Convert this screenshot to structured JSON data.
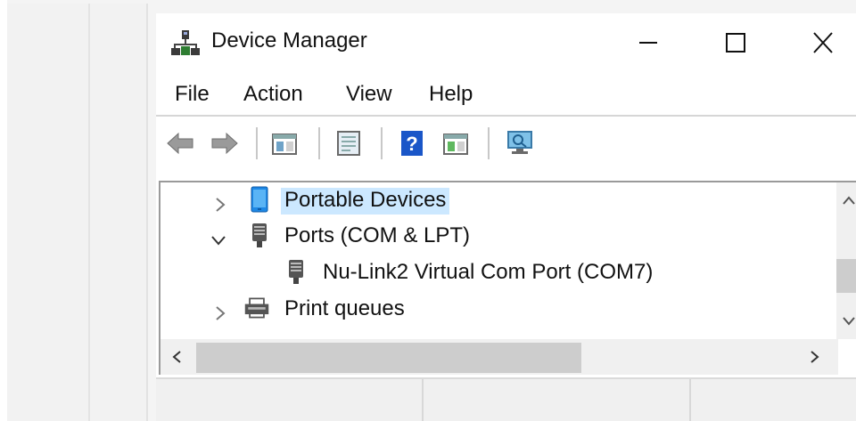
{
  "window": {
    "title": "Device Manager",
    "controls": {
      "minimize": "minimize",
      "maximize": "maximize",
      "close": "close"
    }
  },
  "menu": {
    "items": [
      "File",
      "Action",
      "View",
      "Help"
    ]
  },
  "toolbar": {
    "icons": [
      "back-arrow-icon",
      "forward-arrow-icon",
      "show-hide-console-tree-icon",
      "properties-icon",
      "help-icon",
      "update-driver-icon",
      "scan-hardware-changes-icon"
    ]
  },
  "tree": {
    "nodes": [
      {
        "label": "Portable Devices",
        "expanded": false,
        "selected": true,
        "icon": "portable-device-icon"
      },
      {
        "label": "Ports (COM & LPT)",
        "expanded": true,
        "selected": false,
        "icon": "port-icon"
      },
      {
        "label": "Nu-Link2 Virtual Com Port (COM7)",
        "child": true,
        "icon": "port-icon"
      },
      {
        "label": "Print queues",
        "expanded": false,
        "selected": false,
        "icon": "printer-icon"
      }
    ]
  },
  "colors": {
    "selection": "#cce8ff",
    "scroll_thumb": "#cdcdcd",
    "help_icon": "#1a56c8"
  },
  "statusbar": {
    "cells": [
      "",
      "",
      ""
    ]
  }
}
